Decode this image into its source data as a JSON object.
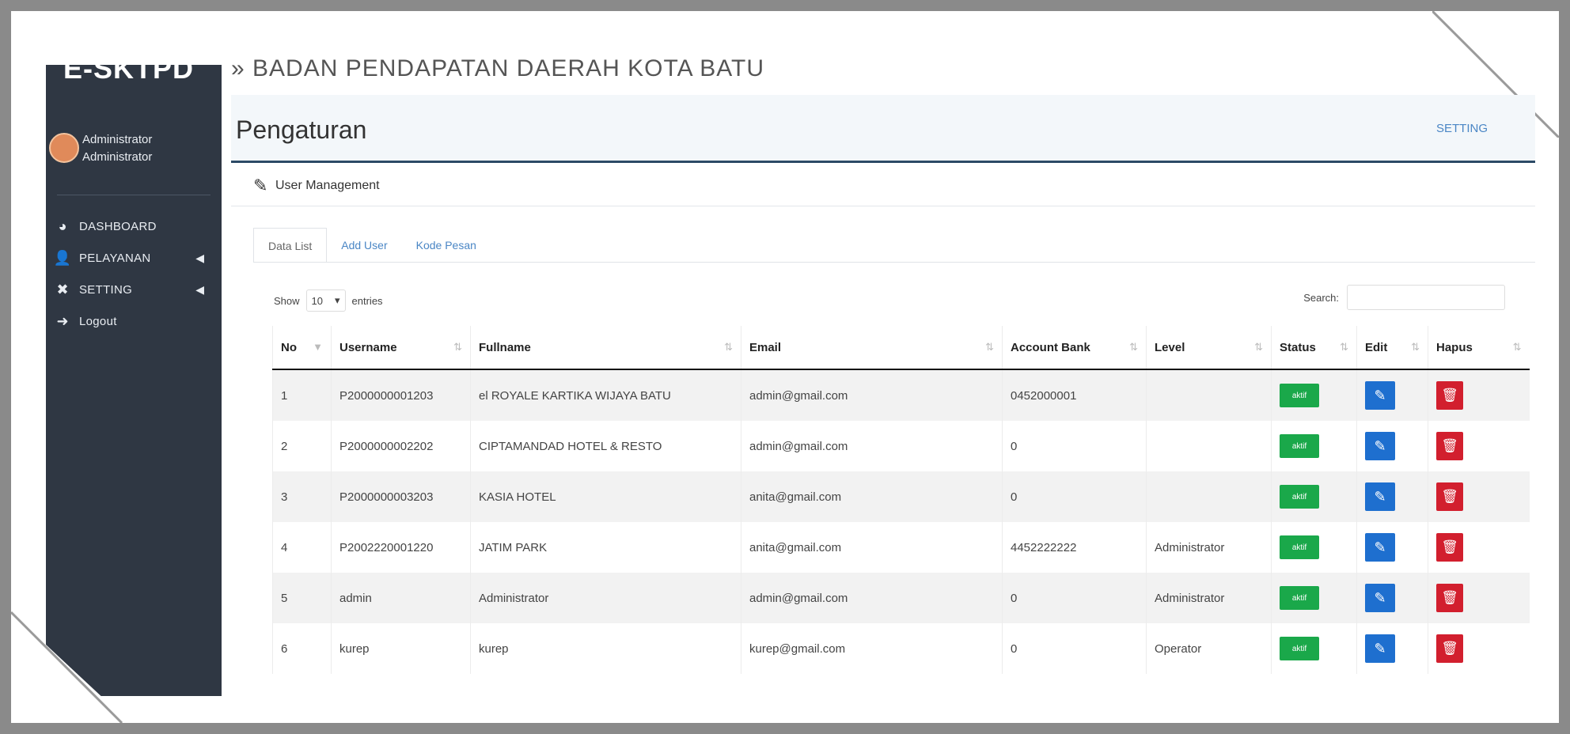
{
  "app": {
    "brand": "E-SKTPD",
    "top_title": "BADAN PENDAPATAN DAERAH KOTA BATU"
  },
  "sidebar": {
    "user": {
      "name": "Administrator",
      "role": "Administrator"
    },
    "items": [
      {
        "label": "DASHBOARD",
        "icon": "dashboard-icon"
      },
      {
        "label": "PELAYANAN",
        "icon": "users-icon",
        "has_submenu": true
      },
      {
        "label": "SETTING",
        "icon": "tools-icon",
        "has_submenu": true
      },
      {
        "label": "Logout",
        "icon": "logout-icon"
      }
    ]
  },
  "header": {
    "title": "Pengaturan",
    "link": "SETTING"
  },
  "panel": {
    "title": "User Management"
  },
  "tabs": [
    {
      "label": "Data List",
      "active": true
    },
    {
      "label": "Add User",
      "active": false
    },
    {
      "label": "Kode Pesan",
      "active": false
    }
  ],
  "table_controls": {
    "show_label": "Show",
    "show_value": "10",
    "entries_label": "entries",
    "search_label": "Search:"
  },
  "table": {
    "columns": [
      "No",
      "Username",
      "Fullname",
      "Email",
      "Account Bank",
      "Level",
      "Status",
      "Edit",
      "Hapus"
    ],
    "rows": [
      {
        "no": "1",
        "username": "P2000000001203",
        "fullname": "el ROYALE KARTIKA WIJAYA BATU",
        "email": "admin@gmail.com",
        "account_bank": "0452000001",
        "level": "",
        "status": "aktif"
      },
      {
        "no": "2",
        "username": "P2000000002202",
        "fullname": "CIPTAMANDAD HOTEL & RESTO",
        "email": "admin@gmail.com",
        "account_bank": "0",
        "level": "",
        "status": "aktif"
      },
      {
        "no": "3",
        "username": "P2000000003203",
        "fullname": "KASIA HOTEL",
        "email": "anita@gmail.com",
        "account_bank": "0",
        "level": "",
        "status": "aktif"
      },
      {
        "no": "4",
        "username": "P2002220001220",
        "fullname": "JATIM PARK",
        "email": "anita@gmail.com",
        "account_bank": "4452222222",
        "level": "Administrator",
        "status": "aktif"
      },
      {
        "no": "5",
        "username": "admin",
        "fullname": "Administrator",
        "email": "admin@gmail.com",
        "account_bank": "0",
        "level": "Administrator",
        "status": "aktif"
      },
      {
        "no": "6",
        "username": "kurep",
        "fullname": "kurep",
        "email": "kurep@gmail.com",
        "account_bank": "0",
        "level": "Operator",
        "status": "aktif"
      }
    ]
  },
  "colors": {
    "sidebar_bg": "#2f3743",
    "status_green": "#1aa84a",
    "edit_blue": "#1e6fcf",
    "delete_red": "#d21f2e",
    "link_blue": "#4a86c5"
  }
}
